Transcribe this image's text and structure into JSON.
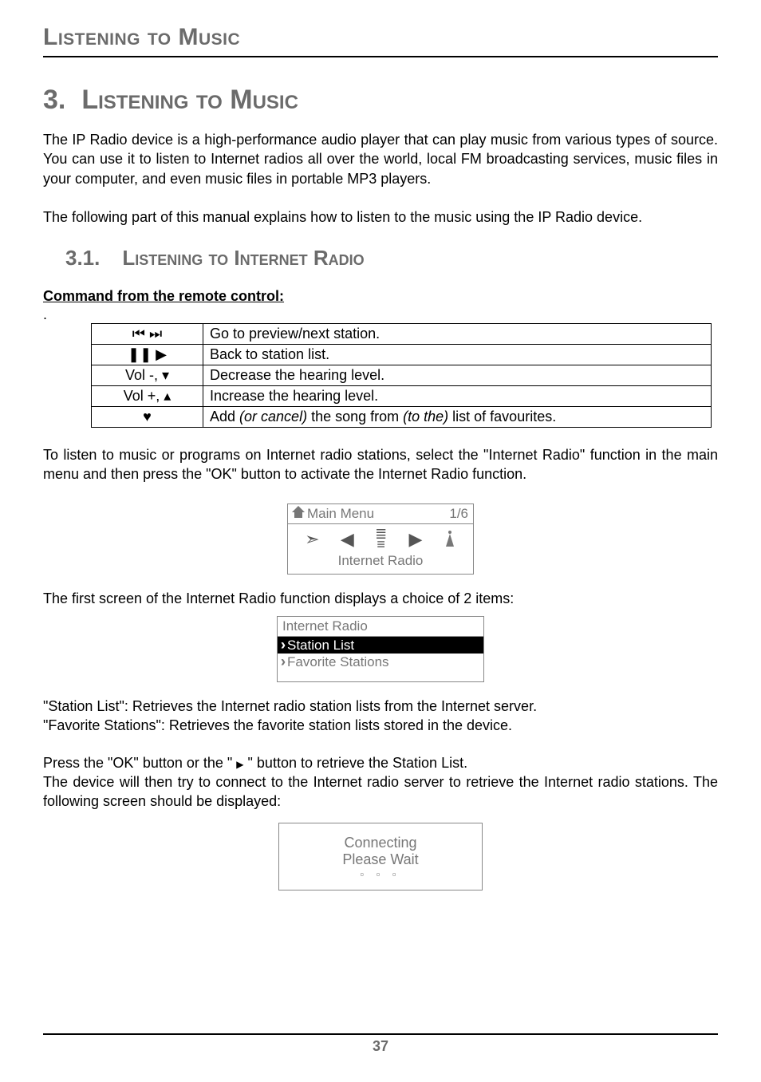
{
  "running_head": "Listening to Music",
  "chapter": {
    "num": "3.",
    "title": "Listening to Music"
  },
  "intro": "The IP Radio device is a high-performance audio player that can play music from various types of source. You can use it to listen to Internet radios all over the world, local FM broadcasting services, music files in your computer, and even music files in portable MP3 players.",
  "intro2": "The following part of this manual explains how to listen to the music using the IP Radio device.",
  "section": {
    "num": "3.1.",
    "title": "Listening to Internet Radio"
  },
  "cmd_heading": "Command from the remote control:",
  "table": {
    "rows": [
      {
        "key_html": "⏮ ⏭",
        "desc": "Go to preview/next  station."
      },
      {
        "key_html": "❚❚  ▶",
        "desc": "Back to station list."
      },
      {
        "key_html": "Vol -, ▾",
        "desc": "Decrease the hearing level."
      },
      {
        "key_html": "Vol +, ▴",
        "desc": "Increase the hearing level."
      },
      {
        "key_html": "♥",
        "desc_pre": "Add ",
        "desc_it1": "(or cancel)",
        "desc_mid": " the song from  ",
        "desc_it2": "(to the)",
        "desc_post": " list of favourites."
      }
    ]
  },
  "para_after_table": "To listen to music or programs on Internet radio stations, select the \"Internet Radio\" function in the main menu and then press the \"OK\" button to activate the Internet Radio function.",
  "screen1": {
    "title": "Main Menu",
    "page": "1/6",
    "icons": {
      "left_off": "➣",
      "left": "◀",
      "right": "▶",
      "center_top": "≣",
      "center_bot": "≡"
    },
    "caption": "Internet Radio"
  },
  "para_after_s1": "The first screen of the Internet Radio function displays a choice of 2 items:",
  "screen2": {
    "header": "Internet Radio",
    "item_sel": "Station List",
    "item2": "Favorite Stations"
  },
  "desc_station_list": "\"Station List\": Retrieves the Internet radio station lists from the Internet server.",
  "desc_fav": "\"Favorite Stations\": Retrieves the favorite station lists stored in the device.",
  "press_ok_pre": "Press the \"OK\" button or the \" ",
  "press_ok_arrow": "▶",
  "press_ok_post": " \" button to retrieve the Station List.",
  "connect_para": "The device will then try to connect to the Internet radio server to retrieve the Internet radio stations. The following screen should be displayed:",
  "screen3": {
    "l1": "Connecting",
    "l2": "Please Wait",
    "dots": "▫ ▫ ▫"
  },
  "page_number": "37"
}
